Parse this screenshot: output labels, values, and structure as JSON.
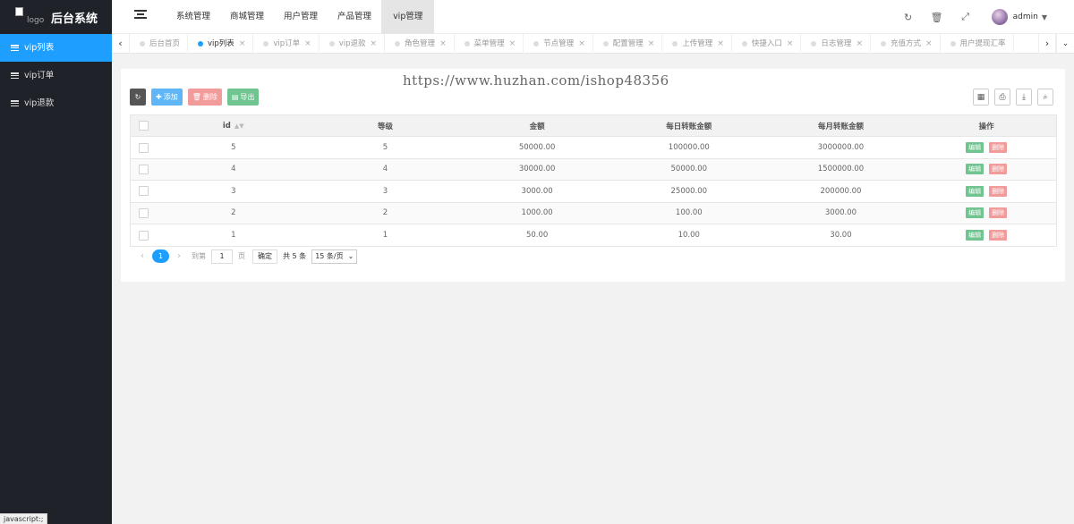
{
  "header": {
    "logo_alt": "logo",
    "title": "后台系统",
    "nav": [
      "系统管理",
      "商城管理",
      "用户管理",
      "产品管理",
      "vip管理"
    ],
    "active_nav": 4,
    "user": "admin"
  },
  "sidebar": {
    "items": [
      {
        "label": "vip列表"
      },
      {
        "label": "vip订单"
      },
      {
        "label": "vip退款"
      }
    ],
    "active": 0
  },
  "tabs": [
    {
      "label": "后台首页",
      "closable": false
    },
    {
      "label": "vip列表",
      "closable": true
    },
    {
      "label": "vip订单",
      "closable": true
    },
    {
      "label": "vip退款",
      "closable": true
    },
    {
      "label": "角色管理",
      "closable": true
    },
    {
      "label": "菜单管理",
      "closable": true
    },
    {
      "label": "节点管理",
      "closable": true
    },
    {
      "label": "配置管理",
      "closable": true
    },
    {
      "label": "上传管理",
      "closable": true
    },
    {
      "label": "快捷入口",
      "closable": true
    },
    {
      "label": "日志管理",
      "closable": true
    },
    {
      "label": "充值方式",
      "closable": true
    },
    {
      "label": "用户提现汇率",
      "closable": false
    }
  ],
  "active_tab": 1,
  "watermark": "https://www.huzhan.com/ishop48356",
  "toolbar": {
    "add_label": "添加",
    "delete_label": "删除",
    "export_label": "导出"
  },
  "table": {
    "headers": [
      "id",
      "等级",
      "金额",
      "每日转账金额",
      "每月转账金额",
      "操作"
    ],
    "rows": [
      [
        "5",
        "5",
        "50000.00",
        "100000.00",
        "3000000.00"
      ],
      [
        "4",
        "4",
        "30000.00",
        "50000.00",
        "1500000.00"
      ],
      [
        "3",
        "3",
        "3000.00",
        "25000.00",
        "200000.00"
      ],
      [
        "2",
        "2",
        "1000.00",
        "100.00",
        "3000.00"
      ],
      [
        "1",
        "1",
        "50.00",
        "10.00",
        "30.00"
      ]
    ],
    "edit_label": "编辑",
    "delete_label": "删除"
  },
  "pagination": {
    "current": "1",
    "goto_prefix": "到第",
    "goto_value": "1",
    "goto_suffix": "页",
    "confirm": "确定",
    "total": "共 5 条",
    "page_size": "15 条/页"
  },
  "status_bar": "javascript:;",
  "colors": {
    "sidebar_bg": "#20222a",
    "accent": "#1e9fff",
    "edit": "#6fc48f",
    "delete": "#f19b9b"
  }
}
